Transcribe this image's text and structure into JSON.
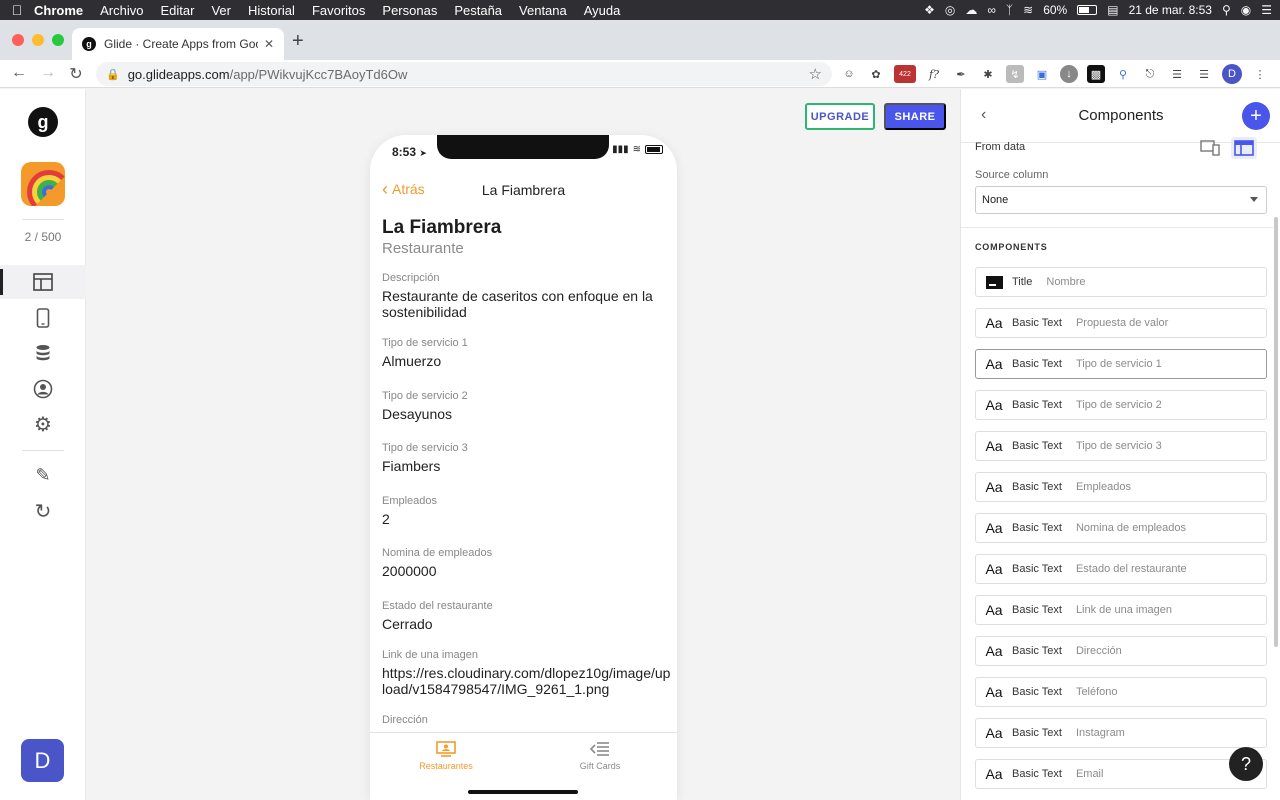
{
  "menubar": {
    "app": "Chrome",
    "items": [
      "Archivo",
      "Editar",
      "Ver",
      "Historial",
      "Favoritos",
      "Personas",
      "Pestaña",
      "Ventana",
      "Ayuda"
    ],
    "battery": "60%",
    "datetime": "21 de mar.  8:53"
  },
  "browser": {
    "tab_title": "Glide · Create Apps from Goog",
    "url_host": "go.glideapps.com",
    "url_path": "/app/PWikvujKcc7BAoyTd6Ow",
    "ext_badge": "422",
    "profile_initial": "D"
  },
  "rail": {
    "logo": "g",
    "app_count": "2 / 500",
    "user_initial": "D"
  },
  "actions": {
    "upgrade": "UPGRADE",
    "share": "SHARE"
  },
  "phone": {
    "time": "8:53",
    "back": "Atrás",
    "nav_title": "La Fiambrera",
    "title": "La Fiambrera",
    "subtitle": "Restaurante",
    "fields": [
      {
        "label": "Descripción",
        "value": "Restaurante de caseritos con enfoque en la sostenibilidad"
      },
      {
        "label": "Tipo de servicio 1",
        "value": "Almuerzo"
      },
      {
        "label": "Tipo de servicio 2",
        "value": "Desayunos"
      },
      {
        "label": "Tipo de servicio 3",
        "value": "Fiambers"
      },
      {
        "label": "Empleados",
        "value": "2"
      },
      {
        "label": "Nomina de empleados",
        "value": "2000000"
      },
      {
        "label": "Estado del restaurante",
        "value": "Cerrado"
      },
      {
        "label": "Link de una imagen",
        "value": "https://res.cloudinary.com/dlopez10g/image/upload/v1584798547/IMG_9261_1.png"
      },
      {
        "label": "Dirección",
        "value": ""
      }
    ],
    "tabs": [
      {
        "label": "Restaurantes",
        "color": "#f39a2b"
      },
      {
        "label": "Gift Cards",
        "color": "#8a8a8a"
      }
    ]
  },
  "panel": {
    "title": "Components",
    "from_data": "From data",
    "source_label": "Source column",
    "source_value": "None",
    "components_heading": "COMPONENTS",
    "components": [
      {
        "icon": "title",
        "type": "Title",
        "value": "Nombre"
      },
      {
        "icon": "Aa",
        "type": "Basic Text",
        "value": "Propuesta de valor"
      },
      {
        "icon": "Aa",
        "type": "Basic Text",
        "value": "Tipo de servicio 1"
      },
      {
        "icon": "Aa",
        "type": "Basic Text",
        "value": "Tipo de servicio 2"
      },
      {
        "icon": "Aa",
        "type": "Basic Text",
        "value": "Tipo de servicio 3"
      },
      {
        "icon": "Aa",
        "type": "Basic Text",
        "value": "Empleados"
      },
      {
        "icon": "Aa",
        "type": "Basic Text",
        "value": "Nomina de empleados"
      },
      {
        "icon": "Aa",
        "type": "Basic Text",
        "value": "Estado del restaurante"
      },
      {
        "icon": "Aa",
        "type": "Basic Text",
        "value": "Link de una imagen"
      },
      {
        "icon": "Aa",
        "type": "Basic Text",
        "value": "Dirección"
      },
      {
        "icon": "Aa",
        "type": "Basic Text",
        "value": "Teléfono"
      },
      {
        "icon": "Aa",
        "type": "Basic Text",
        "value": "Instagram"
      },
      {
        "icon": "Aa",
        "type": "Basic Text",
        "value": "Email"
      }
    ],
    "help": "?"
  },
  "colors": {
    "accent": "#4a55ec",
    "app_orange": "#f39a2b",
    "upgrade_border": "#2bb673"
  }
}
